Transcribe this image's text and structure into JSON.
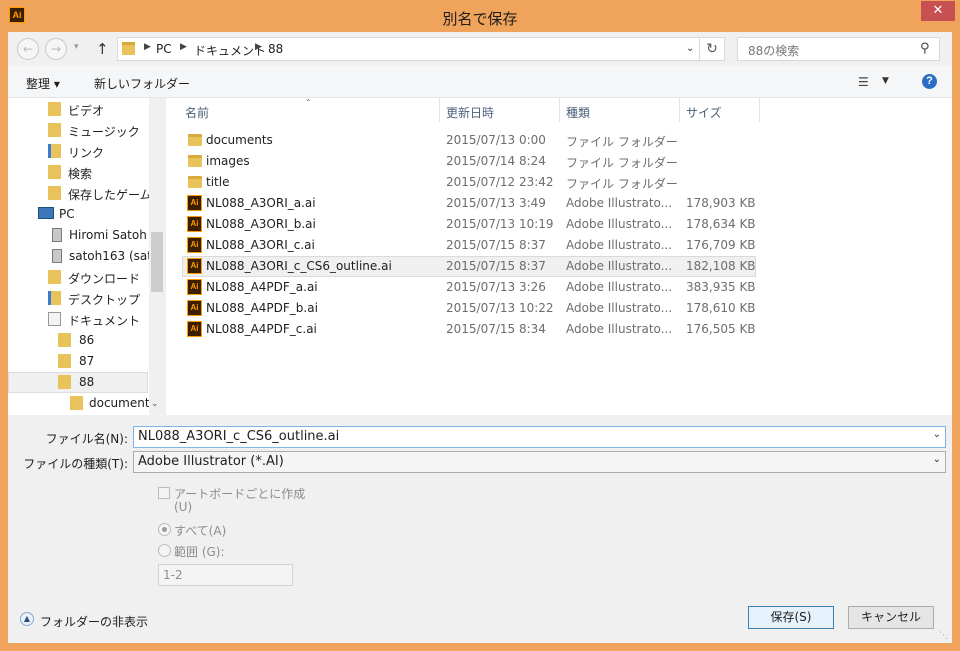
{
  "window": {
    "title": "別名で保存",
    "app_icon": "Ai",
    "close": "✕"
  },
  "address": {
    "crumbs": [
      "PC",
      "ドキュメント",
      "88"
    ],
    "search_placeholder": "88の検索"
  },
  "toolbar": {
    "organize": "整理 ▾",
    "new_folder": "新しいフォルダー"
  },
  "nav": {
    "items": [
      {
        "label": "ビデオ",
        "icon": "video-folder-icon"
      },
      {
        "label": "ミュージック",
        "icon": "music-folder-icon"
      },
      {
        "label": "リンク",
        "icon": "links-folder-icon"
      },
      {
        "label": "検索",
        "icon": "search-folder-icon"
      },
      {
        "label": "保存したゲーム",
        "icon": "games-folder-icon"
      },
      {
        "label": "PC",
        "icon": "computer-icon"
      },
      {
        "label": "Hiromi Satoh",
        "icon": "network-drive-icon"
      },
      {
        "label": "satoh163 (sat",
        "icon": "network-drive-icon"
      },
      {
        "label": "ダウンロード",
        "icon": "downloads-folder-icon"
      },
      {
        "label": "デスクトップ",
        "icon": "desktop-folder-icon"
      },
      {
        "label": "ドキュメント",
        "icon": "documents-folder-icon"
      },
      {
        "label": "86",
        "icon": "folder-icon"
      },
      {
        "label": "87",
        "icon": "folder-icon"
      },
      {
        "label": "88",
        "icon": "folder-icon"
      },
      {
        "label": "document",
        "icon": "folder-icon"
      }
    ]
  },
  "columns": {
    "name": "名前",
    "date": "更新日時",
    "type": "種類",
    "size": "サイズ"
  },
  "files": [
    {
      "name": "documents",
      "date": "2015/07/13 0:00",
      "type": "ファイル フォルダー",
      "size": "",
      "kind": "folder"
    },
    {
      "name": "images",
      "date": "2015/07/14 8:24",
      "type": "ファイル フォルダー",
      "size": "",
      "kind": "folder"
    },
    {
      "name": "title",
      "date": "2015/07/12 23:42",
      "type": "ファイル フォルダー",
      "size": "",
      "kind": "folder"
    },
    {
      "name": "NL088_A3ORI_a.ai",
      "date": "2015/07/13 3:49",
      "type": "Adobe Illustrato...",
      "size": "178,903 KB",
      "kind": "ai"
    },
    {
      "name": "NL088_A3ORI_b.ai",
      "date": "2015/07/13 10:19",
      "type": "Adobe Illustrato...",
      "size": "178,634 KB",
      "kind": "ai"
    },
    {
      "name": "NL088_A3ORI_c.ai",
      "date": "2015/07/15 8:37",
      "type": "Adobe Illustrato...",
      "size": "176,709 KB",
      "kind": "ai"
    },
    {
      "name": "NL088_A3ORI_c_CS6_outline.ai",
      "date": "2015/07/15 8:37",
      "type": "Adobe Illustrato...",
      "size": "182,108 KB",
      "kind": "ai"
    },
    {
      "name": "NL088_A4PDF_a.ai",
      "date": "2015/07/13 3:26",
      "type": "Adobe Illustrato...",
      "size": "383,935 KB",
      "kind": "ai"
    },
    {
      "name": "NL088_A4PDF_b.ai",
      "date": "2015/07/13 10:22",
      "type": "Adobe Illustrato...",
      "size": "178,610 KB",
      "kind": "ai"
    },
    {
      "name": "NL088_A4PDF_c.ai",
      "date": "2015/07/15 8:34",
      "type": "Adobe Illustrato...",
      "size": "176,505 KB",
      "kind": "ai"
    }
  ],
  "selected_file_index": 6,
  "form": {
    "filename_label": "ファイル名(N):",
    "filename_value": "NL088_A3ORI_c_CS6_outline.ai",
    "filetype_label": "ファイルの種類(T):",
    "filetype_value": "Adobe Illustrator (*.AI)",
    "artboards_label": "アートボードごとに作成",
    "artboards_label2": "(U)",
    "all_label": "すべて(A)",
    "range_label": "範囲 (G):",
    "range_value": "1-2"
  },
  "footer": {
    "hide_folders": "フォルダーの非表示",
    "save": "保存(S)",
    "cancel": "キャンセル"
  }
}
